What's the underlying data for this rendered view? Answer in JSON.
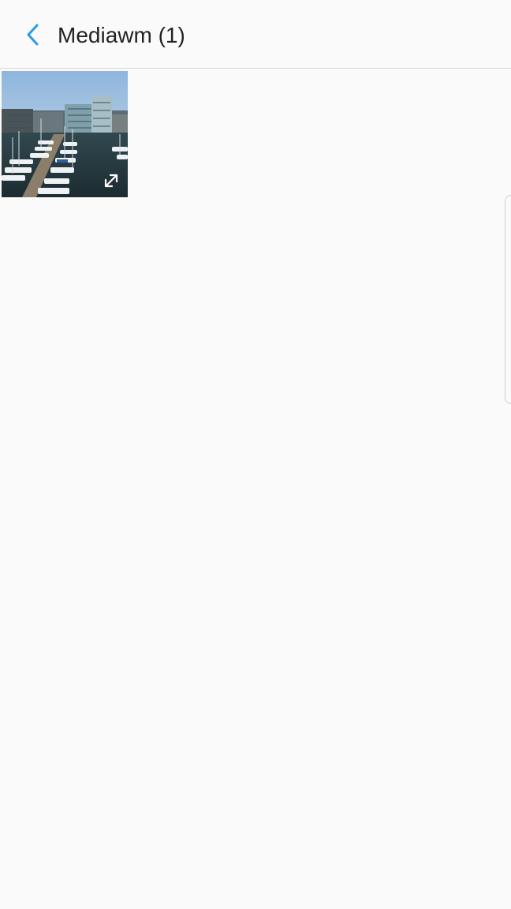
{
  "header": {
    "title": "Mediawm (1)",
    "back_icon": "chevron-left-icon"
  },
  "album": {
    "items": [
      {
        "type": "image",
        "depicts": "marina-harbour-photo",
        "overlay_icon": "expand-icon"
      }
    ]
  },
  "colors": {
    "accent": "#2b9ae8",
    "background": "#fafafa",
    "divider": "#d8d8d8",
    "title_text": "#222222"
  }
}
